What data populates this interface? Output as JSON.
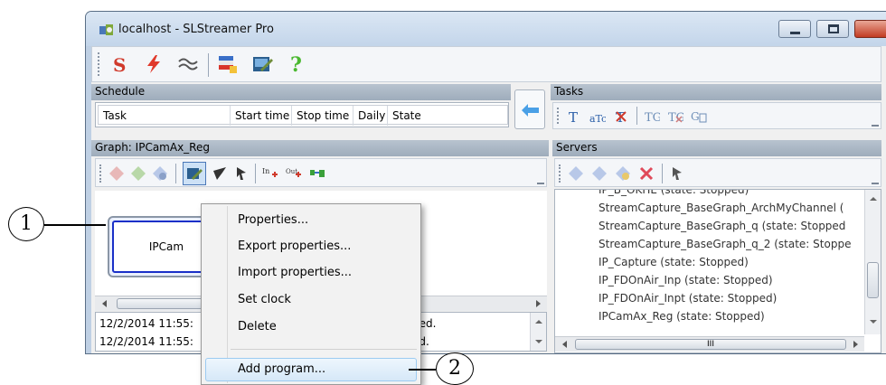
{
  "window": {
    "title": "localhost - SLStreamer Pro"
  },
  "main_toolbar": {
    "icons": [
      "s-logo-icon",
      "lightning-icon",
      "wave-icon",
      "flag-settings-icon",
      "graph-edit-icon",
      "help-icon"
    ]
  },
  "schedule": {
    "header": "Schedule",
    "columns": [
      "Task",
      "Start time",
      "Stop time",
      "Daily",
      "State"
    ]
  },
  "tasks": {
    "header": "Tasks"
  },
  "graph": {
    "header": "Graph: IPCamAx_Reg",
    "node_label": "IPCam"
  },
  "log": {
    "lines": [
      {
        "time": "12/2/2014 11:55:",
        "tail": "ped."
      },
      {
        "time": "12/2/2014 11:55:",
        "tail": "ed."
      }
    ]
  },
  "servers": {
    "header": "Servers",
    "items": [
      "IP_B_OKHE (state: Stopped)",
      "StreamCapture_BaseGraph_ArchMyChannel (",
      "StreamCapture_BaseGraph_q (state: Stopped",
      "StreamCapture_BaseGraph_q_2 (state: Stoppe",
      "IP_Capture (state: Stopped)",
      "IP_FDOnAir_Inp (state: Stopped)",
      "IP_FDOnAir_Inpt (state: Stopped)",
      "IPCamAx_Reg (state: Stopped)"
    ],
    "hscroll_grip": "III"
  },
  "context_menu": {
    "items": [
      "Properties...",
      "Export properties...",
      "Import properties...",
      "Set clock",
      "Delete",
      "Add program..."
    ]
  },
  "callouts": {
    "one": "1",
    "two": "2"
  },
  "colors": {
    "title_bar": "#c3d5ea",
    "panel_header": "#9eacbb",
    "node_border": "#1a30c8",
    "menu_highlight": "#d6e8f8"
  }
}
